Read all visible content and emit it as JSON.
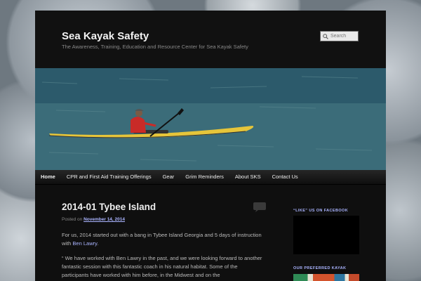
{
  "site": {
    "title": "Sea Kayak Safety",
    "description": "The Awareness, Training, Education and Resource Center for Sea Kayak Safety"
  },
  "search": {
    "placeholder": "Search"
  },
  "nav": {
    "items": [
      {
        "label": "Home",
        "active": true
      },
      {
        "label": "CPR and First Aid Training Offerings"
      },
      {
        "label": "Gear"
      },
      {
        "label": "Grim Reminders"
      },
      {
        "label": "About SKS"
      },
      {
        "label": "Contact Us"
      }
    ]
  },
  "post": {
    "title": "2014-01 Tybee Island",
    "posted_label": "Posted on",
    "date": "November 14, 2014",
    "p1_before": "For us, 2014 started out with a bang in Tybee Island Georgia and 5 days of instruction with ",
    "p1_link": "Ben Lawry",
    "p1_after": ".",
    "p2": "“ We have worked with Ben Lawry in the past, and we were looking forward to another fantastic session with this fantastic coach in his natural habitat. Some of the participants have worked with him before, in the Midwest and on the"
  },
  "sidebar": {
    "facebook_heading": "“Like” us on Facebook",
    "kayak_heading": "Our Preferred Kayak"
  },
  "colors": {
    "link": "#aab4ff",
    "page_bg": "#0f0f0f",
    "kayak_hull": "#e6c53a"
  },
  "icons": {
    "search": "search-icon",
    "comment": "comment-bubble-icon"
  }
}
